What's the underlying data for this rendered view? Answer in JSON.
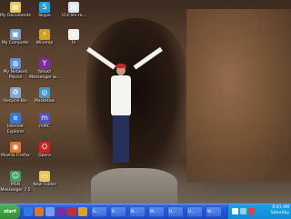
{
  "desktop": {
    "icons": [
      {
        "label": "My Documents",
        "icon": "folder-documents-icon",
        "color": "#e8c45a"
      },
      {
        "label": "My Computer",
        "icon": "computer-icon",
        "color": "#7a9cc8"
      },
      {
        "label": "My Network Places",
        "icon": "network-places-icon",
        "color": "#5f8fd0"
      },
      {
        "label": "Recycle Bin",
        "icon": "recycle-bin-icon",
        "color": "#7fa8d8"
      },
      {
        "label": "Internet Explorer",
        "icon": "internet-explorer-icon",
        "color": "#2f7ae0"
      },
      {
        "label": "Mozilla Firefox",
        "icon": "firefox-icon",
        "color": "#e0742a"
      },
      {
        "label": "MSN Messenger 7.5",
        "icon": "msn-messenger-icon",
        "color": "#3aa35a"
      },
      {
        "label": "Skype",
        "icon": "skype-icon",
        "color": "#1fa0e0"
      },
      {
        "label": "Winamp",
        "icon": "winamp-icon",
        "color": "#d0a020"
      },
      {
        "label": "Yahoo! Messenger w...",
        "icon": "yahoo-messenger-icon",
        "color": "#7a2ca0"
      },
      {
        "label": "Marketow",
        "icon": "marketow-icon",
        "color": "#3a9ad0"
      },
      {
        "label": "mIRC",
        "icon": "mirc-icon",
        "color": "#5050c0"
      },
      {
        "label": "Opera",
        "icon": "opera-icon",
        "color": "#d02020"
      },
      {
        "label": "New Folder",
        "icon": "new-folder-icon",
        "color": "#e8c45a"
      },
      {
        "label": "114-lev-ro...",
        "icon": "document-icon",
        "color": "#d8e4f0"
      },
      {
        "label": "hi",
        "icon": "text-file-icon",
        "color": "#f0f0f0"
      }
    ]
  },
  "taskbar": {
    "start_label": "start",
    "quick_launch": [
      {
        "icon": "internet-explorer-icon",
        "color": "#2f7ae0"
      },
      {
        "icon": "firefox-icon",
        "color": "#e0742a"
      },
      {
        "icon": "show-desktop-icon",
        "color": "#6fa0e8"
      },
      {
        "icon": "yahoo-messenger-icon",
        "color": "#7a2ca0"
      },
      {
        "icon": "mozilla-icon",
        "color": "#c03030"
      },
      {
        "icon": "messenger-icon",
        "color": "#e0a020"
      }
    ],
    "buttons": [
      {
        "label": "G...",
        "icon": "folder-icon"
      },
      {
        "label": "R...",
        "icon": "media-icon"
      },
      {
        "label": "N...",
        "icon": "notepad-icon"
      },
      {
        "label": "M...",
        "icon": "messenger-icon"
      },
      {
        "label": "U...",
        "icon": "browser-icon"
      },
      {
        "label": "U...",
        "icon": "browser-icon"
      },
      {
        "label": "W...",
        "icon": "window-icon"
      }
    ],
    "clock": {
      "time": "6:41 AM",
      "day": "Saturday"
    }
  }
}
